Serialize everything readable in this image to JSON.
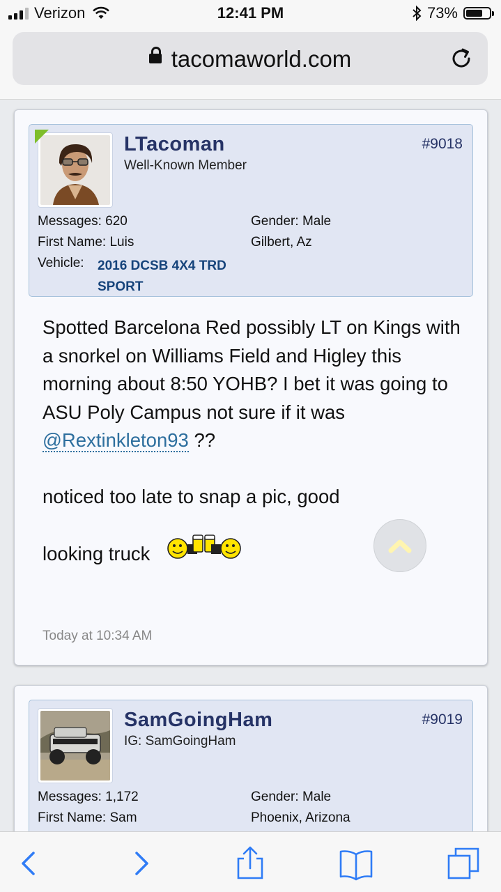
{
  "status_bar": {
    "carrier": "Verizon",
    "time": "12:41 PM",
    "battery_percent": "73%",
    "battery_level": 0.73,
    "icons": [
      "signal-icon",
      "wifi-icon",
      "bluetooth-icon",
      "battery-icon"
    ]
  },
  "browser": {
    "url": "tacomaworld.com",
    "icons": [
      "lock-icon",
      "reload-icon"
    ]
  },
  "posts": [
    {
      "username": "LTacoman",
      "user_title": "Well-Known Member",
      "post_number": "#9018",
      "online": true,
      "messages_label": "Messages:",
      "messages": "620",
      "first_name_label": "First Name:",
      "first_name": "Luis",
      "vehicle_label": "Vehicle:",
      "vehicle": "2016 DCSB 4X4 TRD SPORT",
      "gender_label": "Gender:",
      "gender": "Male",
      "location": "Gilbert, Az",
      "message_part1": "Spotted Barcelona Red possibly LT on Kings with a snorkel on Williams Field and Higley this morning about 8:50 YOHB? I bet it was going to ASU Poly Campus not sure if it was ",
      "mention": "@Rextinkleton93",
      "message_part2": " ??",
      "message_line2a": "noticed too late to snap a pic, good",
      "message_line2b": "looking truck",
      "smiley": "beer-cheers-smiley",
      "post_time": "Today at 10:34 AM"
    },
    {
      "username": "SamGoingHam",
      "user_title": "IG: SamGoingHam",
      "post_number": "#9019",
      "online": false,
      "messages_label": "Messages:",
      "messages": "1,172",
      "first_name_label": "First Name:",
      "first_name": "Sam",
      "gender_label": "Gender:",
      "gender": "Male",
      "location": "Phoenix, Arizona"
    }
  ],
  "toolbar": {
    "items": [
      "back-icon",
      "forward-icon",
      "share-icon",
      "bookmarks-icon",
      "tabs-icon"
    ]
  }
}
